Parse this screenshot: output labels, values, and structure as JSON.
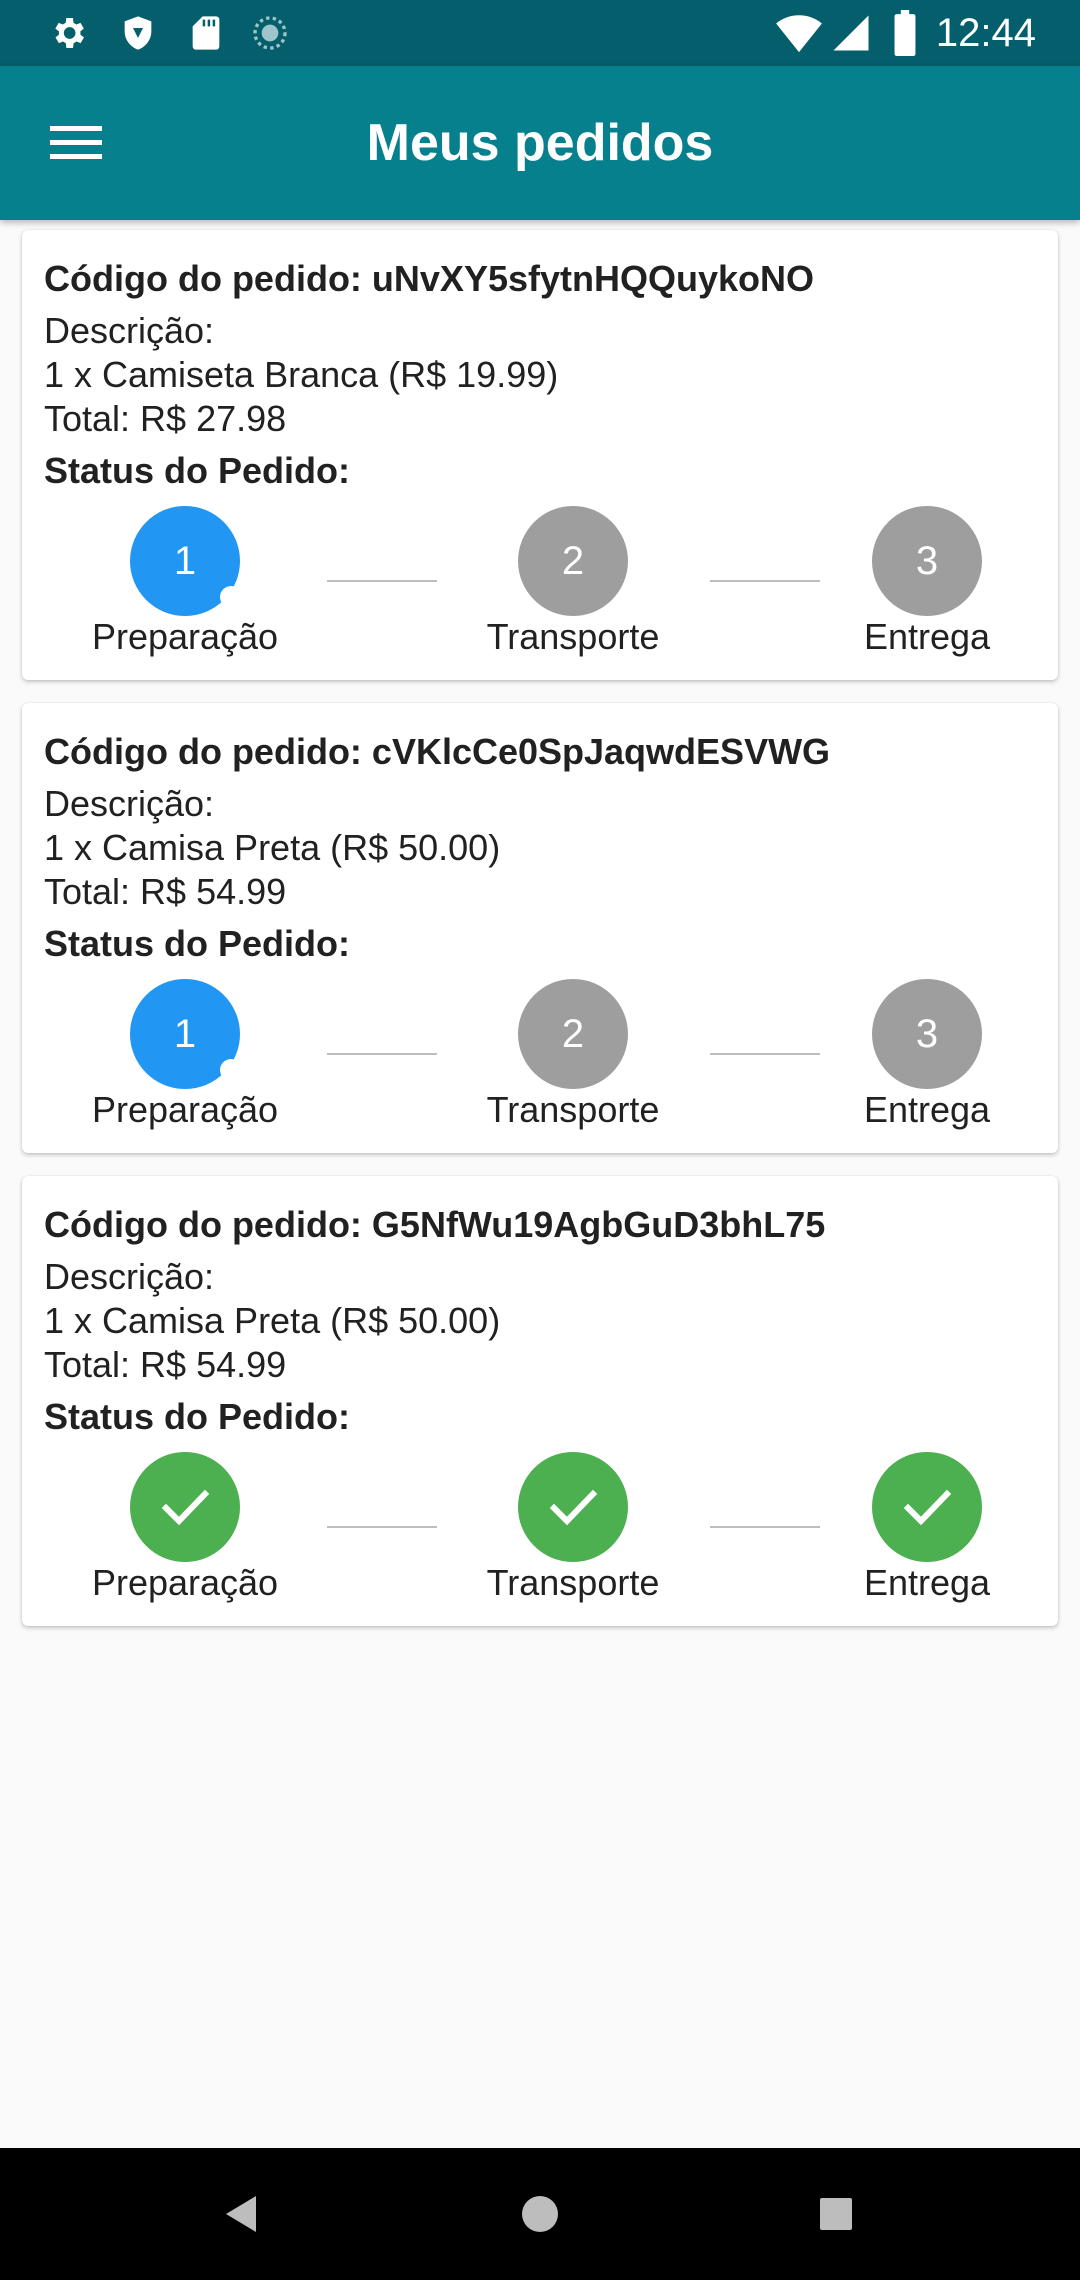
{
  "status_bar": {
    "time": "12:44"
  },
  "app_bar": {
    "title": "Meus pedidos"
  },
  "orders": [
    {
      "code": "Código do pedido: uNvXY5sfytnHQQuykoNO",
      "description_label": "Descrição:",
      "item": "1 x Camiseta Branca (R$ 19.99)",
      "total": "Total: R$ 27.98",
      "status_label": "Status do Pedido:",
      "steps": [
        {
          "number": "1",
          "label": "Preparação",
          "state": "active"
        },
        {
          "number": "2",
          "label": "Transporte",
          "state": "pending"
        },
        {
          "number": "3",
          "label": "Entrega",
          "state": "pending"
        }
      ]
    },
    {
      "code": "Código do pedido: cVKlcCe0SpJaqwdESVWG",
      "description_label": "Descrição:",
      "item": "1 x Camisa Preta (R$ 50.00)",
      "total": "Total: R$ 54.99",
      "status_label": "Status do Pedido:",
      "steps": [
        {
          "number": "1",
          "label": "Preparação",
          "state": "active"
        },
        {
          "number": "2",
          "label": "Transporte",
          "state": "pending"
        },
        {
          "number": "3",
          "label": "Entrega",
          "state": "pending"
        }
      ]
    },
    {
      "code": "Código do pedido: G5NfWu19AgbGuD3bhL75",
      "description_label": "Descrição:",
      "item": "1 x Camisa Preta (R$ 50.00)",
      "total": "Total: R$ 54.99",
      "status_label": "Status do Pedido:",
      "steps": [
        {
          "number": "",
          "label": "Preparação",
          "state": "done"
        },
        {
          "number": "",
          "label": "Transporte",
          "state": "done"
        },
        {
          "number": "",
          "label": "Entrega",
          "state": "done"
        }
      ]
    }
  ],
  "colors": {
    "status_bar": "#055e6b",
    "app_bar": "#06808d",
    "active_step": "#2196f3",
    "pending_step": "#9e9e9e",
    "done_step": "#4caf50"
  },
  "icons": {
    "status_left": [
      "gear-icon",
      "shield-icon",
      "sd-card-icon",
      "sync-icon"
    ],
    "status_right": [
      "wifi-icon",
      "signal-icon",
      "battery-icon"
    ],
    "app_bar": "menu-icon",
    "done_step": "check-icon",
    "nav": [
      "back-icon",
      "home-icon",
      "recents-icon"
    ]
  }
}
